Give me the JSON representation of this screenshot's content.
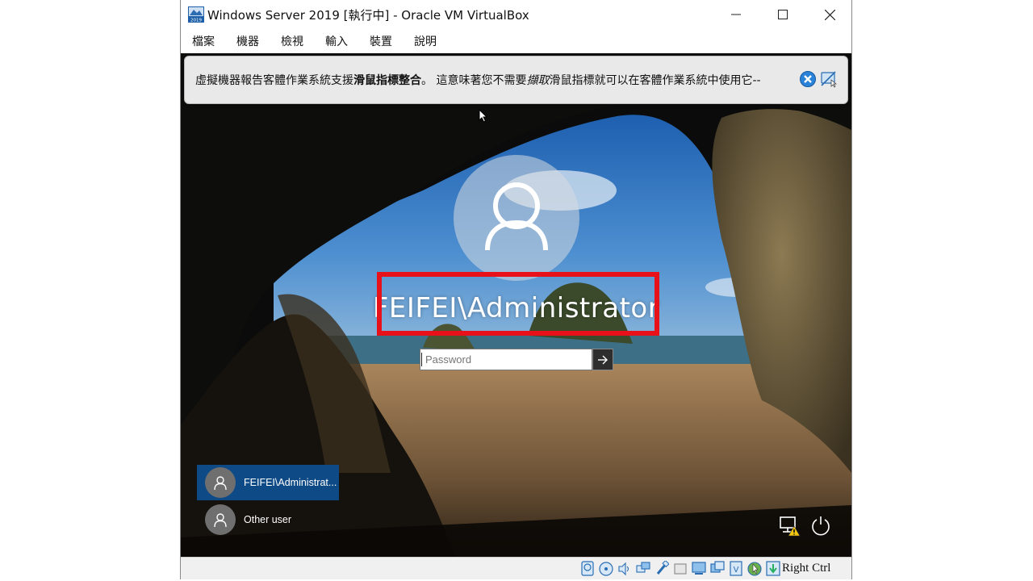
{
  "window": {
    "title": "Windows Server 2019 [執行中] - Oracle VM VirtualBox",
    "app_icon": "virtualbox-vm-icon",
    "app_icon_text": "2019",
    "controls": [
      "minimize-icon",
      "maximize-icon",
      "close-icon"
    ]
  },
  "menu": {
    "items": [
      {
        "label": "檔案"
      },
      {
        "label": "機器"
      },
      {
        "label": "檢視"
      },
      {
        "label": "輸入"
      },
      {
        "label": "裝置"
      },
      {
        "label": "說明"
      }
    ]
  },
  "notification": {
    "text_prefix": "虛擬機器報告客體作業系統支援",
    "text_bold": "滑鼠指標整合",
    "text_middle": "。 這意味著您不需要",
    "text_italic": "擷取",
    "text_suffix": "滑鼠指標就可以在客體作業系統中使用它--",
    "close_icon": "close-notification-icon",
    "mute_icon": "do-not-show-again-icon"
  },
  "login": {
    "username": "FEIFEI\\Administrator",
    "password_placeholder": "Password",
    "password_value": "",
    "submit_icon": "arrow-right-icon",
    "highlight_color": "#e8111a"
  },
  "users": [
    {
      "label": "FEIFEI\\Administrat...",
      "selected": true
    },
    {
      "label": "Other user",
      "selected": false
    }
  ],
  "system_icons": [
    "network-warning-icon",
    "power-options-icon"
  ],
  "statusbar": {
    "icons": [
      "hard-disk-icon",
      "optical-drive-icon",
      "audio-icon",
      "network-icon",
      "usb-icon",
      "shared-folders-icon",
      "display-icon",
      "recording-icon",
      "cpu-virtualization-icon",
      "mouse-integration-icon",
      "keyboard-capture-icon"
    ],
    "host_key": "Right Ctrl"
  },
  "colors": {
    "selected_user_bg": "#0e4a86",
    "notification_bg": "#e9e9e9"
  }
}
